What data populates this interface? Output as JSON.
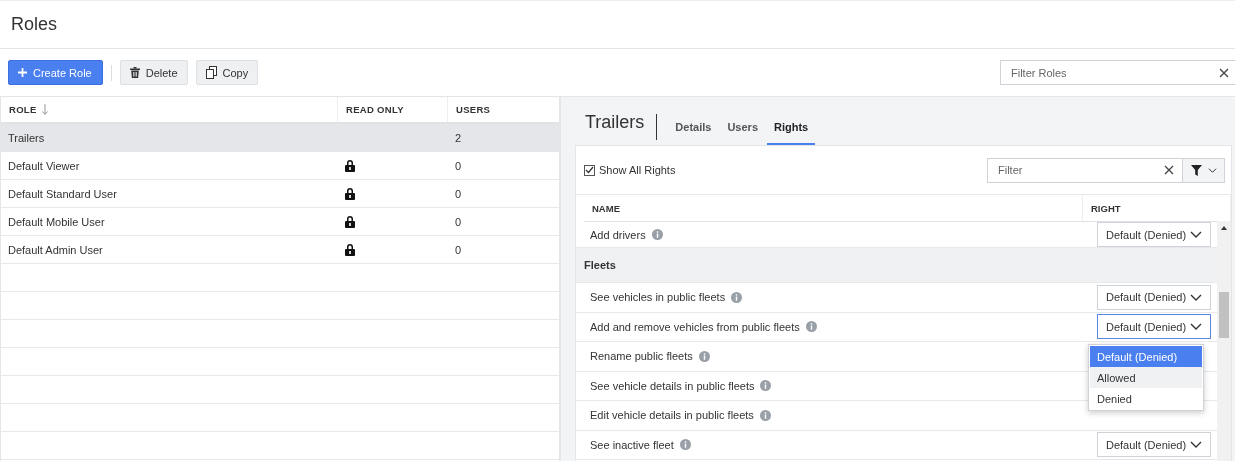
{
  "page_title": "Roles",
  "toolbar": {
    "buttons": [
      {
        "kind": "primary",
        "label": "Create Role"
      },
      {
        "kind": "delete",
        "label": "Delete"
      },
      {
        "kind": "copy",
        "label": "Copy"
      }
    ],
    "filter": {
      "placeholder": "Filter Roles"
    }
  },
  "roles_table": {
    "columns": [
      "ROLE",
      "READ ONLY",
      "USERS"
    ],
    "rows": [
      {
        "role": "Trailers",
        "read_only": false,
        "users": "2",
        "selected": true
      },
      {
        "role": "Default Viewer",
        "read_only": true,
        "users": "0",
        "selected": false
      },
      {
        "role": "Default Standard User",
        "read_only": true,
        "users": "0",
        "selected": false
      },
      {
        "role": "Default Mobile User",
        "read_only": true,
        "users": "0",
        "selected": false
      },
      {
        "role": "Default Admin User",
        "read_only": true,
        "users": "0",
        "selected": false
      }
    ]
  },
  "detail": {
    "title": "Trailers",
    "tabs": [
      {
        "label": "Details",
        "selected": false
      },
      {
        "label": "Users",
        "selected": false
      },
      {
        "label": "Rights",
        "selected": true
      }
    ],
    "show_all_rights": {
      "label": "Show All Rights",
      "checked": true
    },
    "filter": {
      "placeholder": "Filter"
    },
    "columns": [
      "NAME",
      "RIGHT"
    ],
    "rights": [
      {
        "kind": "right",
        "name": "Add drivers",
        "right": "Default (Denied)",
        "focused": false
      },
      {
        "kind": "group",
        "name": "Fleets"
      },
      {
        "kind": "right",
        "name": "See vehicles in public fleets",
        "right": "Default (Denied)",
        "focused": false
      },
      {
        "kind": "right",
        "name": "Add and remove vehicles from public fleets",
        "right": "Default (Denied)",
        "focused": true
      },
      {
        "kind": "right",
        "name": "Rename public fleets"
      },
      {
        "kind": "right",
        "name": "See vehicle details in public fleets"
      },
      {
        "kind": "right",
        "name": "Edit vehicle details in public fleets"
      },
      {
        "kind": "right",
        "name": "See inactive fleet",
        "right": "Default (Denied)",
        "focused": false
      }
    ],
    "dropdown": {
      "options": [
        {
          "label": "Default (Denied)",
          "selected": true,
          "hovered": false
        },
        {
          "label": "Allowed",
          "selected": false,
          "hovered": true
        },
        {
          "label": "Denied",
          "selected": false,
          "hovered": false
        }
      ]
    }
  }
}
